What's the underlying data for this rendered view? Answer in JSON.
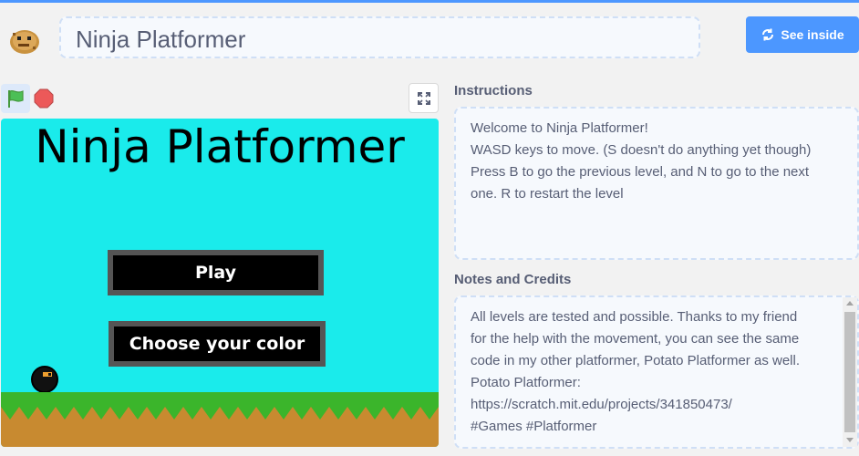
{
  "project": {
    "title": "Ninja Platformer",
    "see_inside_label": "See inside"
  },
  "icons": {
    "avatar": "pixel-potato-avatar",
    "see_inside": "rotate-arrows-icon",
    "green_flag": "green-flag-icon",
    "stop": "stop-sign-icon",
    "fullscreen": "fullscreen-icon"
  },
  "stage": {
    "game_title": "Ninja Platformer",
    "play_label": "Play",
    "choose_color_label": "Choose your color"
  },
  "instructions": {
    "heading": "Instructions",
    "lines": [
      "Welcome to Ninja Platformer!",
      "WASD keys to move. (S doesn't do anything yet though)",
      "Press B to go the previous level, and N to go to the next",
      "one. R to restart the level"
    ]
  },
  "notes": {
    "heading": "Notes and Credits",
    "lines": [
      "All levels are tested and possible. Thanks to my friend",
      "for the help with the movement, you can see the same",
      "code in my other platformer, Potato Platformer as well.",
      "Potato Platformer:",
      "https://scratch.mit.edu/projects/341850473/",
      "#Games #Platformer"
    ]
  },
  "colors": {
    "accent": "#4c97ff",
    "stage_sky": "#1aebeb",
    "grass": "#3bb52b",
    "dirt": "#c88a30",
    "button_border": "#555555"
  }
}
